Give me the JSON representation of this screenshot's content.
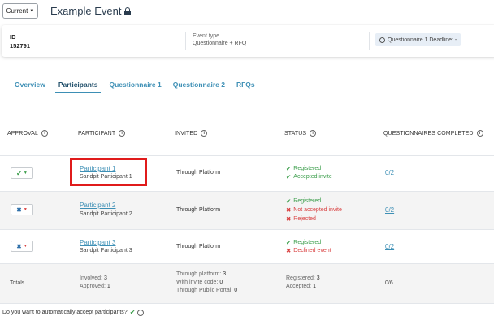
{
  "header": {
    "version_label": "Current",
    "event_title": "Example Event"
  },
  "info": {
    "id_label": "ID",
    "id_value": "152791",
    "event_type_label": "Event type",
    "event_type_value": "Questionnaire + RFQ",
    "deadline_label": "Questionnaire 1 Deadline: -"
  },
  "tabs": [
    {
      "label": "Overview"
    },
    {
      "label": "Participants"
    },
    {
      "label": "Questionnaire 1"
    },
    {
      "label": "Questionnaire 2"
    },
    {
      "label": "RFQs"
    }
  ],
  "active_tab": "Participants",
  "columns": {
    "approval": "APPROVAL",
    "participant": "PARTICIPANT",
    "invited": "INVITED",
    "status": "STATUS",
    "questionnaires": "QUESTIONNAIRES COMPLETED"
  },
  "rows": [
    {
      "approval": "approved",
      "name": "Participant 1",
      "sub": "Sandpit Participant 1",
      "invited": "Through Platform",
      "status": [
        {
          "type": "ok",
          "text": "Registered"
        },
        {
          "type": "ok",
          "text": "Accepted invite"
        }
      ],
      "questionnaires": "0/2"
    },
    {
      "approval": "rejected",
      "name": "Participant 2",
      "sub": "Sandpit Participant 2",
      "invited": "Through Platform",
      "status": [
        {
          "type": "ok",
          "text": "Registered"
        },
        {
          "type": "bad",
          "text": "Not accepted invite"
        },
        {
          "type": "bad",
          "text": "Rejected"
        }
      ],
      "questionnaires": "0/2"
    },
    {
      "approval": "rejected",
      "name": "Participant 3",
      "sub": "Sandpit Participant 3",
      "invited": "Through Platform",
      "status": [
        {
          "type": "ok",
          "text": "Registered"
        },
        {
          "type": "bad",
          "text": "Declined event"
        }
      ],
      "questionnaires": "0/2"
    }
  ],
  "totals": {
    "label": "Totals",
    "involved_label": "Involved:",
    "involved_value": "3",
    "approved_label": "Approved:",
    "approved_value": "1",
    "through_platform_label": "Through platform:",
    "through_platform_value": "3",
    "invite_code_label": "With invite code:",
    "invite_code_value": "0",
    "public_portal_label": "Through Public Portal:",
    "public_portal_value": "0",
    "registered_label": "Registered:",
    "registered_value": "3",
    "accepted_label": "Accepted:",
    "accepted_value": "1",
    "questionnaires_value": "0/6"
  },
  "footer_question": "Do you want to automatically accept participants?",
  "colors": {
    "accent": "#3d8fb5",
    "ok": "#3a9d4a",
    "bad": "#d94040",
    "highlight": "#e01b1b"
  }
}
